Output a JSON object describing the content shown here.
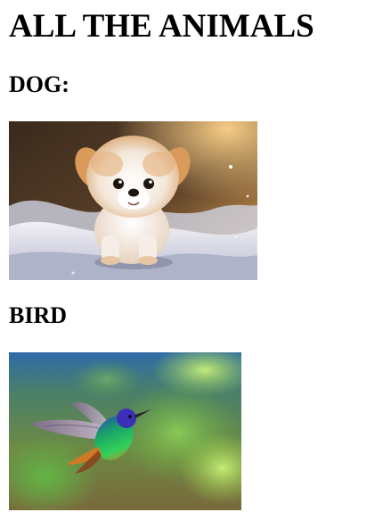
{
  "page": {
    "title": "ALL THE ANIMALS"
  },
  "sections": [
    {
      "heading": "DOG:",
      "image": "puppy-photo"
    },
    {
      "heading": "BIRD",
      "image": "hummingbird-photo"
    }
  ]
}
